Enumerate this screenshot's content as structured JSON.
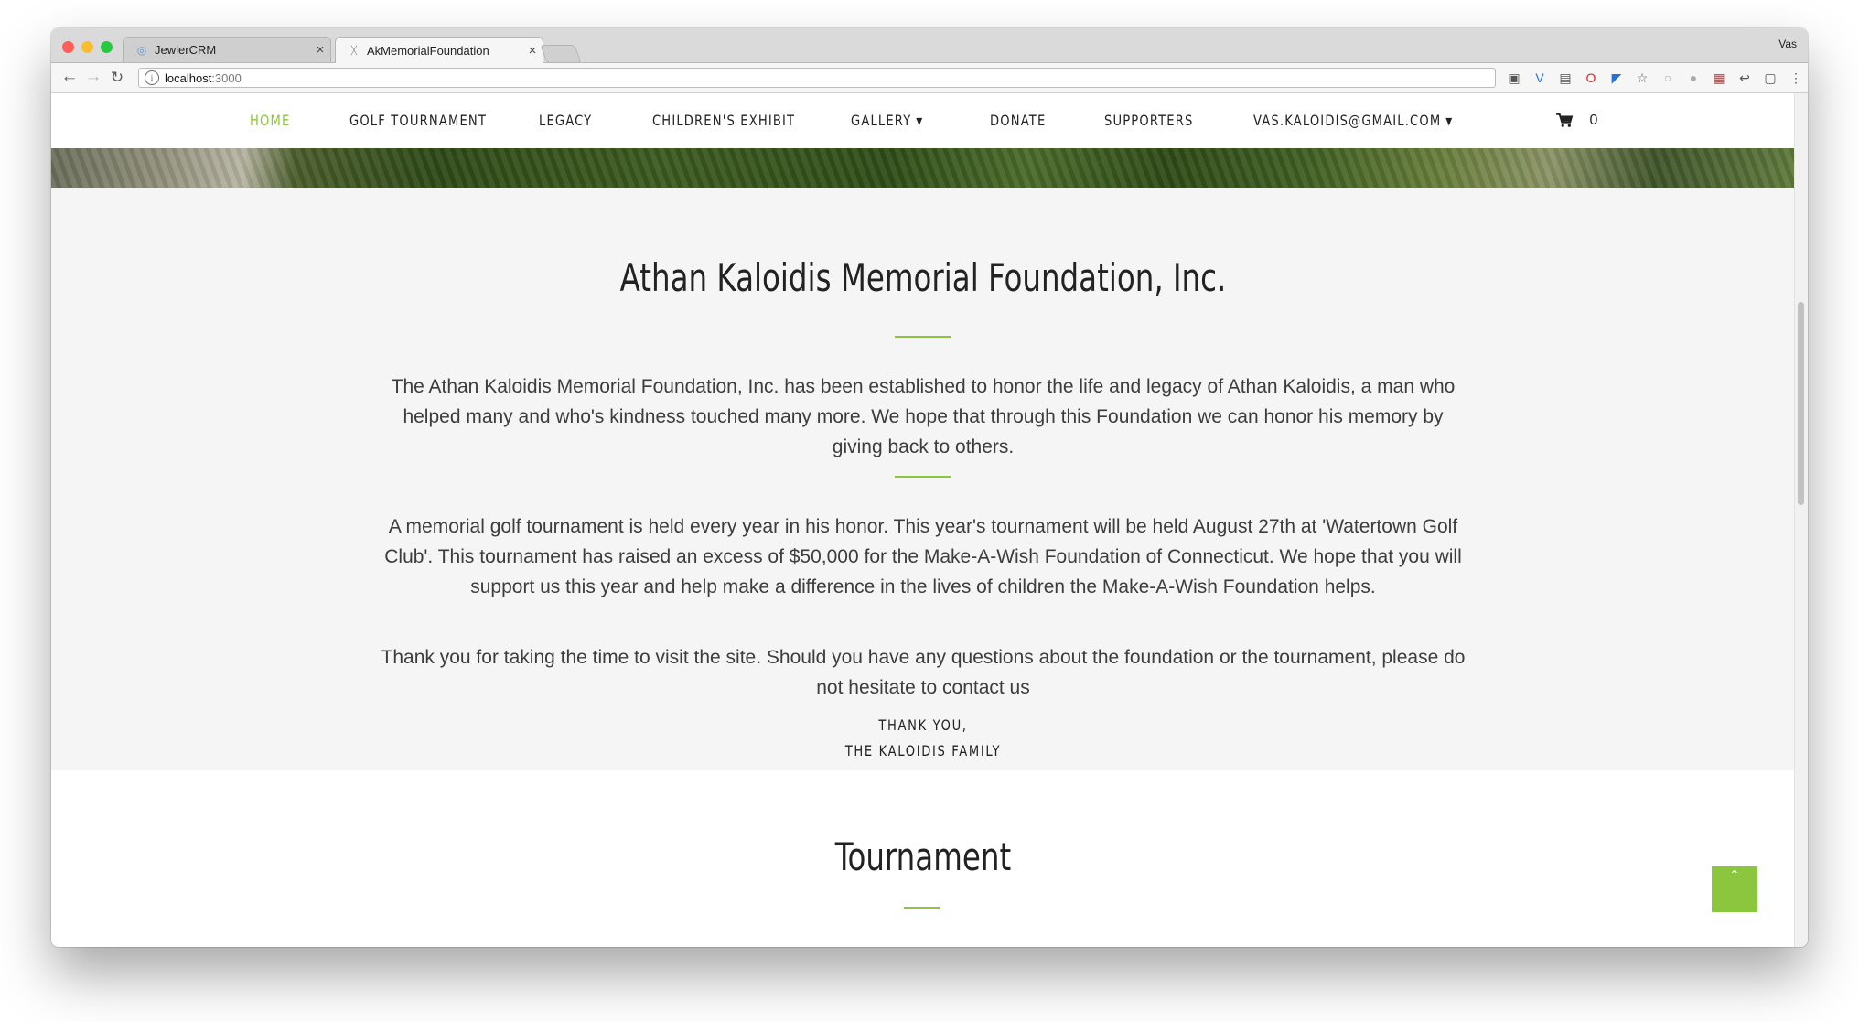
{
  "browser": {
    "tabs": [
      {
        "title": "JewlerCRM",
        "close": "×"
      },
      {
        "title": "AkMemorialFoundation",
        "close": "×"
      }
    ],
    "profile": "Vas",
    "address": {
      "host": "localhost",
      "port": ":3000"
    }
  },
  "nav": {
    "items": [
      {
        "label": "HOME",
        "active": true
      },
      {
        "label": "GOLF TOURNAMENT"
      },
      {
        "label": "LEGACY"
      },
      {
        "label": "CHILDREN'S EXHIBIT"
      },
      {
        "label": "GALLERY"
      },
      {
        "label": "DONATE"
      },
      {
        "label": "SUPPORTERS"
      },
      {
        "label": "VAS.KALOIDIS@GMAIL.COM"
      }
    ],
    "cart_count": "0"
  },
  "about": {
    "title": "Athan Kaloidis Memorial Foundation, Inc.",
    "paragraph1": "The Athan Kaloidis Memorial Foundation, Inc. has been established to honor the life and legacy of Athan Kaloidis, a man who helped many and who's kindness touched many more. We hope that through this Foundation we can honor his memory by giving back to others.",
    "paragraph2": "A memorial golf tournament is held every year in his honor. This year's tournament will be held August 27th at 'Watertown Golf Club'. This tournament has raised an excess of $50,000 for the Make-A-Wish Foundation of Connecticut. We hope that you will support us this year and help make a difference in the lives of children the Make-A-Wish Foundation helps.",
    "paragraph3": "Thank you for taking the time to visit the site. Should you have any questions about the foundation or the tournament, please do not hesitate to contact us",
    "signoff_line1": "THANK YOU,",
    "signoff_line2": "THE KALOIDIS FAMILY"
  },
  "tournament": {
    "title": "Tournament"
  },
  "back_to_top": "ˆ",
  "colors": {
    "accent": "#8cc63f",
    "section_bg": "#f5f5f5",
    "text": "#3d3d3d"
  }
}
